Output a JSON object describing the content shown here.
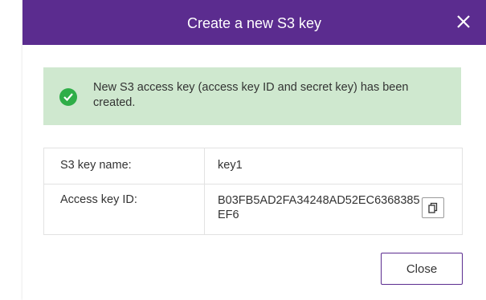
{
  "colors": {
    "header_background": "#5b2c8f",
    "success_background": "#cfe8cf",
    "success_icon": "#2fae48",
    "button_border": "#5b2c8f"
  },
  "dialog": {
    "title": "Create a new S3 key",
    "close_icon": "close-icon"
  },
  "alert": {
    "icon": "check-circle-icon",
    "message": "New S3 access key (access key ID and secret key) has been created."
  },
  "details": {
    "rows": [
      {
        "label": "S3 key name:",
        "value": "key1"
      },
      {
        "label": "Access key ID:",
        "value": "B03FB5AD2FA34248AD52EC6368385EF6",
        "action_icon": "copy-icon"
      }
    ]
  },
  "footer": {
    "close_label": "Close"
  }
}
